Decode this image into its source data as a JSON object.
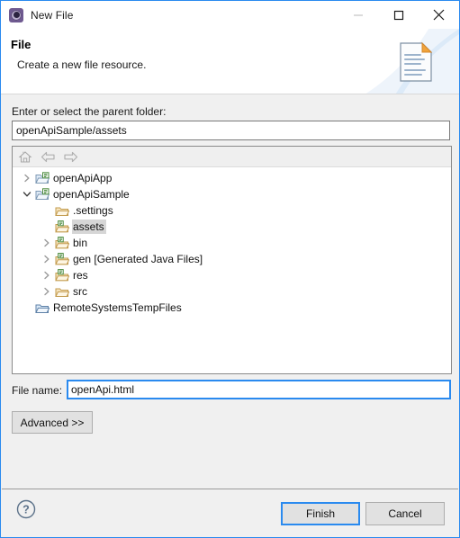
{
  "window": {
    "title": "New File",
    "icon": "eclipse-gear-icon",
    "border_color": "#2a8aef",
    "controls": {
      "minimize": "minimize-icon",
      "maximize": "maximize-icon",
      "close": "close-icon"
    }
  },
  "header": {
    "title": "File",
    "subtitle": "Create a new file resource.",
    "icon": "new-file-document-icon"
  },
  "parent_folder": {
    "label": "Enter or select the parent folder:",
    "value": "openApiSample/assets",
    "placeholder": ""
  },
  "tree": {
    "toolbar": [
      {
        "name": "home-icon",
        "enabled": false
      },
      {
        "name": "back-arrow-icon",
        "enabled": false
      },
      {
        "name": "forward-arrow-icon",
        "enabled": false
      }
    ],
    "rows": [
      {
        "label": "openApiApp",
        "indent": 0,
        "chevron": "collapsed",
        "icon": "project-folder-icon",
        "selected": false
      },
      {
        "label": "openApiSample",
        "indent": 0,
        "chevron": "expanded",
        "icon": "project-folder-icon",
        "selected": false
      },
      {
        "label": ".settings",
        "indent": 1,
        "chevron": "none",
        "icon": "folder-icon",
        "selected": false
      },
      {
        "label": "assets",
        "indent": 1,
        "chevron": "none",
        "icon": "source-folder-icon",
        "selected": true
      },
      {
        "label": "bin",
        "indent": 1,
        "chevron": "collapsed",
        "icon": "source-folder-icon",
        "selected": false
      },
      {
        "label": "gen [Generated Java Files]",
        "indent": 1,
        "chevron": "collapsed",
        "icon": "source-folder-icon",
        "selected": false
      },
      {
        "label": "res",
        "indent": 1,
        "chevron": "collapsed",
        "icon": "source-folder-icon",
        "selected": false
      },
      {
        "label": "src",
        "indent": 1,
        "chevron": "collapsed",
        "icon": "folder-icon",
        "selected": false
      },
      {
        "label": "RemoteSystemsTempFiles",
        "indent": 0,
        "chevron": "none",
        "icon": "remote-folder-icon",
        "selected": false
      }
    ]
  },
  "file_name": {
    "label": "File name:",
    "value": "openApi.html",
    "placeholder": ""
  },
  "advanced": {
    "label": "Advanced >>"
  },
  "footer": {
    "help_icon": "help-question-icon",
    "finish_label": "Finish",
    "cancel_label": "Cancel",
    "default_button": "Finish"
  },
  "colors": {
    "accent": "#2a8aef",
    "dialog_bg": "#f0f0f0",
    "panel_bg": "#ffffff",
    "selection": "#d6d6d6",
    "button_face": "#e1e1e1",
    "button_border": "#adadad"
  }
}
